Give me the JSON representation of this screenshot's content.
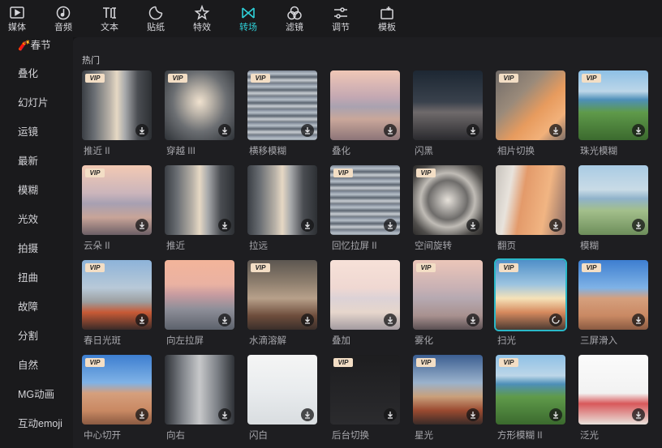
{
  "toolbar": {
    "items": [
      {
        "label": "媒体",
        "icon": "media-icon"
      },
      {
        "label": "音频",
        "icon": "audio-icon"
      },
      {
        "label": "文本",
        "icon": "text-icon"
      },
      {
        "label": "贴纸",
        "icon": "sticker-icon"
      },
      {
        "label": "特效",
        "icon": "effects-icon"
      },
      {
        "label": "转场",
        "icon": "transition-icon",
        "active": true
      },
      {
        "label": "滤镜",
        "icon": "filter-icon"
      },
      {
        "label": "调节",
        "icon": "adjust-icon"
      },
      {
        "label": "模板",
        "icon": "template-icon"
      }
    ],
    "accent_color": "#2fd0d8"
  },
  "sidebar": {
    "items": [
      {
        "label": "🧨春节"
      },
      {
        "label": "叠化"
      },
      {
        "label": "幻灯片"
      },
      {
        "label": "运镜"
      },
      {
        "label": "最新"
      },
      {
        "label": "模糊"
      },
      {
        "label": "光效"
      },
      {
        "label": "拍摄"
      },
      {
        "label": "扭曲"
      },
      {
        "label": "故障"
      },
      {
        "label": "分割"
      },
      {
        "label": "自然"
      },
      {
        "label": "MG动画"
      },
      {
        "label": "互动emoji"
      }
    ]
  },
  "section": {
    "title": "热门"
  },
  "vip_label": "VIP",
  "grid": {
    "cards": [
      {
        "label": "推近 II",
        "vip": true,
        "thumb": "t-city"
      },
      {
        "label": "穿越 III",
        "vip": true,
        "thumb": "t-city2"
      },
      {
        "label": "横移模糊",
        "vip": true,
        "thumb": "t-blur"
      },
      {
        "label": "叠化",
        "vip": false,
        "thumb": "t-sea"
      },
      {
        "label": "闪黑",
        "vip": false,
        "thumb": "t-dark"
      },
      {
        "label": "相片切换",
        "vip": true,
        "thumb": "t-photo"
      },
      {
        "label": "珠光模糊",
        "vip": true,
        "thumb": "t-girl"
      },
      {
        "label": "云朵 II",
        "vip": true,
        "thumb": "t-cloud"
      },
      {
        "label": "推近",
        "vip": false,
        "thumb": "t-city"
      },
      {
        "label": "拉远",
        "vip": false,
        "thumb": "t-city"
      },
      {
        "label": "回忆拉屏 II",
        "vip": true,
        "thumb": "t-blur"
      },
      {
        "label": "空间旋转",
        "vip": true,
        "thumb": "t-swirl"
      },
      {
        "label": "翻页",
        "vip": false,
        "thumb": "t-page"
      },
      {
        "label": "模糊",
        "vip": false,
        "thumb": "t-girl2"
      },
      {
        "label": "春日光斑",
        "vip": true,
        "thumb": "t-car"
      },
      {
        "label": "向左拉屏",
        "vip": false,
        "thumb": "t-sunset"
      },
      {
        "label": "水滴溶解",
        "vip": true,
        "thumb": "t-rain"
      },
      {
        "label": "叠加",
        "vip": false,
        "thumb": "t-pale"
      },
      {
        "label": "雾化",
        "vip": true,
        "thumb": "t-fog"
      },
      {
        "label": "扫光",
        "vip": true,
        "thumb": "t-sweep",
        "selected": true,
        "loading": true
      },
      {
        "label": "三屏滑入",
        "vip": true,
        "thumb": "t-castle"
      },
      {
        "label": "中心切开",
        "vip": true,
        "thumb": "t-castle"
      },
      {
        "label": "向右",
        "vip": false,
        "thumb": "t-mirror"
      },
      {
        "label": "闪白",
        "vip": false,
        "thumb": "t-white"
      },
      {
        "label": "后台切换",
        "vip": true,
        "thumb": "t-phone"
      },
      {
        "label": "星光",
        "vip": true,
        "thumb": "t-star"
      },
      {
        "label": "方形模糊 II",
        "vip": true,
        "thumb": "t-girl"
      },
      {
        "label": "泛光",
        "vip": false,
        "thumb": "t-white2"
      }
    ]
  }
}
